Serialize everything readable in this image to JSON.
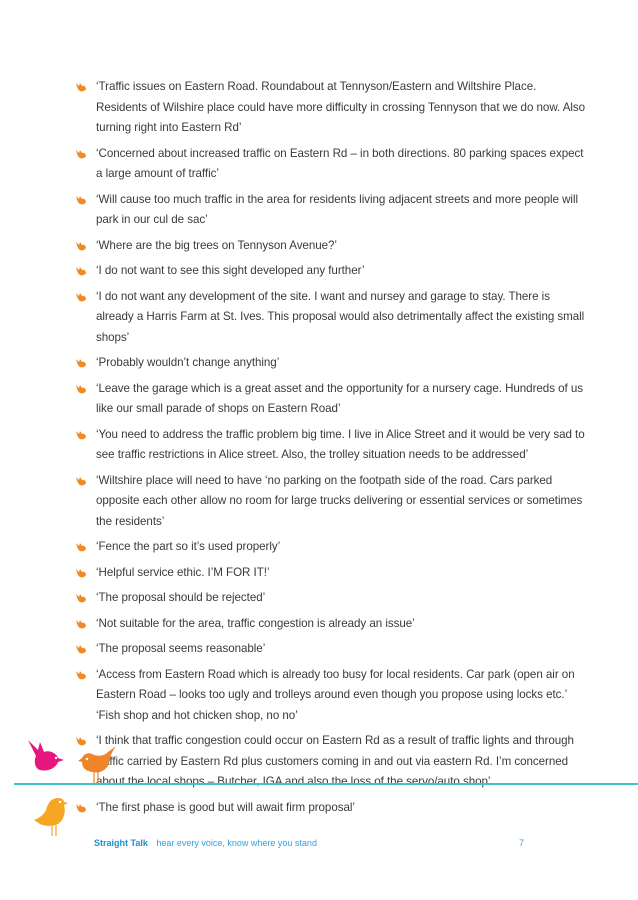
{
  "comments": [
    "‘Traffic issues on Eastern Road. Roundabout at Tennyson/Eastern and Wiltshire Place. Residents of Wilshire place could have more difficulty in crossing Tennyson that we do now. Also turning right into Eastern Rd’",
    "‘Concerned about increased traffic on Eastern Rd – in both directions. 80 parking spaces expect a large amount of traffic’",
    "‘Will cause too much traffic in the area for residents living adjacent streets and more people will park in our cul de sac’",
    "‘Where are the big trees on Tennyson Avenue?’",
    "‘I do not want to see this sight developed any further’",
    "‘I do not want any development of the site. I want and nursey and garage to stay. There is already a Harris Farm at St. Ives. This proposal would also detrimentally affect the existing small shops’",
    "‘Probably wouldn’t change anything’",
    "‘Leave the garage which is a great asset and the opportunity for a nursery cage. Hundreds of us like our small parade of shops on Eastern Road’",
    "‘You need to address the traffic problem big time. I live in Alice Street and it would be very sad to see traffic restrictions in Alice street. Also, the trolley situation needs to be addressed’",
    "‘Wiltshire place will need to have ‘no parking on the footpath side of the road. Cars parked opposite each other allow no room for large trucks delivering or essential services or sometimes the residents’",
    "‘Fence the part so it’s used properly’",
    "‘Helpful service ethic. I’M FOR IT!’",
    "‘The proposal should be rejected’",
    "‘Not suitable for the area, traffic congestion is already an issue’",
    "‘The proposal seems reasonable’",
    "‘Access from Eastern Road which is already too busy for local residents. Car park (open air on Eastern Road – looks too ugly and trolleys around even though you propose using locks etc.’ ‘Fish shop and hot chicken shop, no no’",
    "‘I think that traffic congestion could occur on Eastern Rd as a result of traffic lights and through traffic carried by Eastern Rd plus customers coming in and out via eastern Rd. I’m concerned about the local shops – Butcher, IGA and also the loss of the servo/auto shop’",
    "‘The first phase is good but will await firm proposal’"
  ],
  "footer": {
    "brand": "Straight Talk",
    "tagline": "hear every voice, know where you stand",
    "page_number": "7"
  },
  "colors": {
    "bullet": "#f08a24",
    "rule": "#40c4c8",
    "bird_pink": "#e5177e",
    "bird_orange": "#f0842a",
    "bird_yellow": "#f6a623",
    "footer_text": "#2ea3da"
  }
}
